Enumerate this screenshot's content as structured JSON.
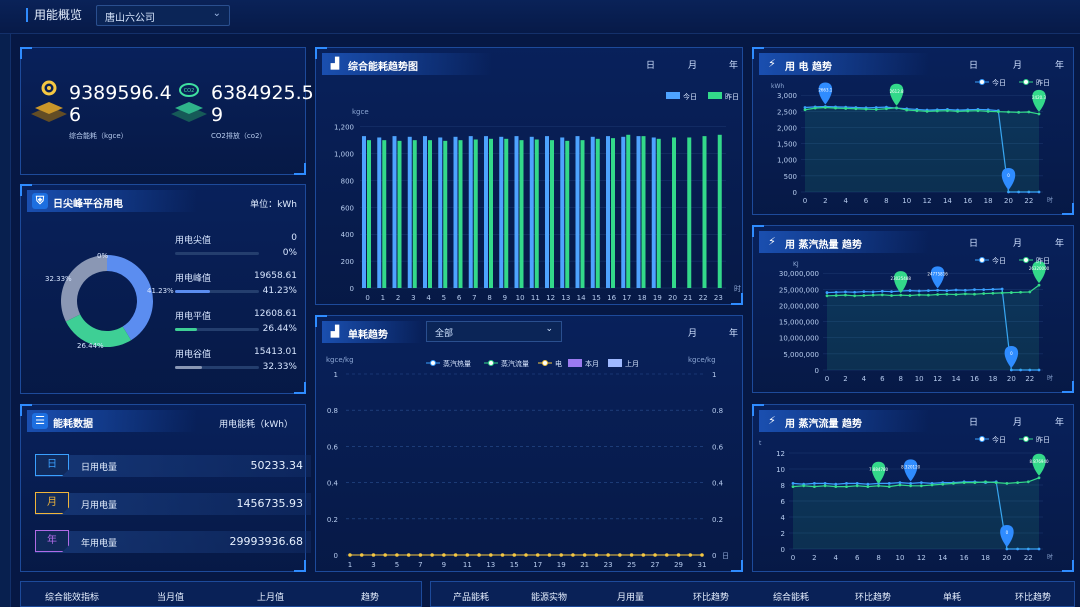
{
  "header": {
    "title": "用能概览",
    "company_select": "唐山六公司"
  },
  "overview": {
    "energy_value": "9389596.46",
    "energy_label": "综合能耗（kgce）",
    "co2_value": "6384925.59",
    "co2_label": "CO2排放（co2）"
  },
  "peak_valley": {
    "title": "日尖峰平谷用电",
    "unit": "单位：kWh",
    "rows": [
      {
        "label": "用电尖值",
        "value": "0",
        "pct": "0%",
        "fraction": 0,
        "color": "#8aa2c8"
      },
      {
        "label": "用电峰值",
        "value": "19658.61",
        "pct": "41.23%",
        "fraction": 0.4123,
        "color": "#5b8df0"
      },
      {
        "label": "用电平值",
        "value": "12608.61",
        "pct": "26.44%",
        "fraction": 0.2644,
        "color": "#3ecf95"
      },
      {
        "label": "用电谷值",
        "value": "15413.01",
        "pct": "32.33%",
        "fraction": 0.3233,
        "color": "#8a97b4"
      }
    ],
    "donut_labels": {
      "jian": "0%",
      "feng": "41.23%",
      "ping": "26.44%",
      "gu": "32.33%"
    }
  },
  "energy_data": {
    "title": "能耗数据",
    "unit": "用电能耗（kWh）",
    "rows": [
      {
        "tag": "日",
        "label": "日用电量",
        "value": "50233.34",
        "color": "#3aa0ff"
      },
      {
        "tag": "月",
        "label": "月用电量",
        "value": "1456735.93",
        "color": "#f0b53a"
      },
      {
        "tag": "年",
        "label": "年用电量",
        "value": "29993936.68",
        "color": "#b06be6"
      }
    ]
  },
  "trend": {
    "title": "综合能耗趋势图",
    "tabs": [
      "日",
      "月",
      "年"
    ],
    "legend": [
      "今日",
      "昨日"
    ],
    "yunit": "kgce",
    "xunit": "时",
    "chart_data": {
      "type": "bar",
      "categories": [
        "0",
        "1",
        "2",
        "3",
        "4",
        "5",
        "6",
        "7",
        "8",
        "9",
        "10",
        "11",
        "12",
        "13",
        "14",
        "15",
        "16",
        "17",
        "18",
        "19",
        "20",
        "21",
        "22",
        "23"
      ],
      "yticks": [
        "0",
        "200",
        "400",
        "600",
        "800",
        "1,000",
        "1,200"
      ],
      "ylim": [
        0,
        1250
      ],
      "series": [
        {
          "name": "今日",
          "color": "#4ea3ff",
          "values": [
            1130,
            1120,
            1130,
            1125,
            1130,
            1120,
            1125,
            1130,
            1130,
            1125,
            1130,
            1125,
            1130,
            1120,
            1130,
            1125,
            1130,
            1125,
            1130,
            1120,
            null,
            null,
            null,
            null
          ]
        },
        {
          "name": "昨日",
          "color": "#33d98a",
          "values": [
            1100,
            1100,
            1095,
            1100,
            1100,
            1095,
            1100,
            1105,
            1110,
            1110,
            1100,
            1105,
            1100,
            1095,
            1100,
            1110,
            1115,
            1140,
            1130,
            1110,
            1120,
            1120,
            1130,
            1140
          ]
        }
      ]
    }
  },
  "unit_trend": {
    "title": "单耗趋势",
    "select": "全部",
    "tabs": [
      "月",
      "年"
    ],
    "yunit_left": "kgce/kg",
    "yunit_right": "kgce/kg",
    "xunit": "日",
    "legend": [
      "蒸汽热量",
      "蒸汽流量",
      "电",
      "本月",
      "上月"
    ],
    "chart_data": {
      "type": "line",
      "x": [
        "1",
        "3",
        "5",
        "7",
        "9",
        "11",
        "13",
        "15",
        "17",
        "19",
        "21",
        "23",
        "25",
        "27",
        "29",
        "31"
      ],
      "yticks": [
        "0",
        "0.2",
        "0.4",
        "0.6",
        "0.8",
        "1"
      ],
      "ylim": [
        0,
        1
      ],
      "series": [
        {
          "name": "电",
          "color": "#f5c842",
          "values": [
            0,
            0,
            0,
            0,
            0,
            0,
            0,
            0,
            0,
            0,
            0,
            0,
            0,
            0,
            0,
            0,
            0,
            0,
            0,
            0,
            0,
            0,
            0,
            0,
            0,
            0,
            0,
            0,
            0,
            0,
            0
          ]
        }
      ]
    }
  },
  "power": {
    "title": "用 电 趋势",
    "tabs": [
      "日",
      "月",
      "年"
    ],
    "legend": [
      "今日",
      "昨日"
    ],
    "yunit": "kWh",
    "xunit": "时",
    "chart_data": {
      "type": "line",
      "x": [
        "0",
        "2",
        "4",
        "6",
        "8",
        "10",
        "12",
        "14",
        "16",
        "18",
        "20",
        "22"
      ],
      "yticks": [
        "0",
        "500",
        "1,000",
        "1,500",
        "2,000",
        "2,500",
        "3,000"
      ],
      "ylim": [
        0,
        3100
      ],
      "series": [
        {
          "name": "今日",
          "color": "#3aa0ff",
          "values": [
            2620,
            2640,
            2650,
            2640,
            2630,
            2620,
            2610,
            2620,
            2630,
            2600,
            2580,
            2560,
            2540,
            2550,
            2560,
            2540,
            2550,
            2560,
            2550,
            2520,
            0,
            0,
            0,
            0
          ]
        },
        {
          "name": "昨日",
          "color": "#33d98a",
          "values": [
            2550,
            2600,
            2620,
            2600,
            2590,
            2580,
            2570,
            2560,
            2580,
            2610,
            2540,
            2520,
            2500,
            2510,
            2520,
            2500,
            2510,
            2520,
            2500,
            2490,
            2480,
            2470,
            2480,
            2420
          ]
        }
      ],
      "markers": [
        {
          "x": "2",
          "label": "2663.1",
          "color": "#2f8cff",
          "series": "今日"
        },
        {
          "x": "9",
          "label": "2612.8",
          "color": "#33d98a",
          "series": "昨日"
        },
        {
          "x": "20",
          "label": "0",
          "color": "#2f8cff",
          "series": "今日"
        },
        {
          "x": "23",
          "label": "2420.3",
          "color": "#33d98a",
          "series": "昨日"
        }
      ]
    }
  },
  "steam_heat": {
    "title": "用 蒸汽热量 趋势",
    "tabs": [
      "日",
      "月",
      "年"
    ],
    "legend": [
      "今日",
      "昨日"
    ],
    "yunit": "KJ",
    "xunit": "时",
    "chart_data": {
      "type": "line",
      "x": [
        "0",
        "2",
        "4",
        "6",
        "8",
        "10",
        "12",
        "14",
        "16",
        "18",
        "20",
        "22"
      ],
      "yticks": [
        "0",
        "5,000,000",
        "10,000,000",
        "15,000,000",
        "20,000,000",
        "25,000,000",
        "30,000,000"
      ],
      "ylim": [
        0,
        31000000
      ],
      "series": [
        {
          "name": "今日",
          "color": "#3aa0ff",
          "values": [
            24000000,
            24100000,
            24200000,
            24100000,
            24300000,
            24200000,
            24400000,
            24300000,
            24500000,
            24600000,
            24500000,
            24600000,
            24700000,
            24600000,
            24800000,
            24700000,
            24900000,
            24900000,
            25000000,
            25100000,
            0,
            0,
            0,
            0
          ]
        },
        {
          "name": "昨日",
          "color": "#33d98a",
          "values": [
            23000000,
            23100000,
            23200000,
            23000000,
            23100000,
            23200000,
            23300000,
            23100000,
            23200000,
            23100000,
            23300000,
            23200000,
            23400000,
            23500000,
            23400000,
            23600000,
            23500000,
            23700000,
            23800000,
            23900000,
            24000000,
            24100000,
            24200000,
            26300000
          ]
        }
      ],
      "markers": [
        {
          "x": "8",
          "label": "23025488",
          "color": "#33d98a",
          "series": "昨日"
        },
        {
          "x": "12",
          "label": "24775816",
          "color": "#2f8cff",
          "series": "今日"
        },
        {
          "x": "20",
          "label": "0",
          "color": "#2f8cff",
          "series": "今日"
        },
        {
          "x": "23",
          "label": "26320000",
          "color": "#33d98a",
          "series": "昨日"
        }
      ]
    }
  },
  "steam_flow": {
    "title": "用 蒸汽流量 趋势",
    "tabs": [
      "日",
      "月",
      "年"
    ],
    "legend": [
      "今日",
      "昨日"
    ],
    "yunit": "t",
    "xunit": "时",
    "chart_data": {
      "type": "line",
      "x": [
        "0",
        "2",
        "4",
        "6",
        "8",
        "10",
        "12",
        "14",
        "16",
        "18",
        "20",
        "22"
      ],
      "yticks": [
        "0",
        "2",
        "4",
        "6",
        "8",
        "10",
        "12"
      ],
      "ylim": [
        0,
        12.5
      ],
      "series": [
        {
          "name": "今日",
          "color": "#3aa0ff",
          "values": [
            8.2,
            8.1,
            8.2,
            8.2,
            8.1,
            8.2,
            8.2,
            8.1,
            8.2,
            8.2,
            8.3,
            8.2,
            8.3,
            8.2,
            8.3,
            8.3,
            8.4,
            8.4,
            8.3,
            8.4,
            0,
            0,
            0,
            0
          ]
        },
        {
          "name": "昨日",
          "color": "#33d98a",
          "values": [
            7.8,
            7.9,
            7.8,
            7.9,
            7.8,
            7.8,
            7.9,
            7.8,
            7.9,
            7.8,
            8.0,
            7.9,
            7.9,
            8.0,
            8.1,
            8.2,
            8.3,
            8.3,
            8.4,
            8.3,
            8.2,
            8.3,
            8.4,
            8.9
          ]
        }
      ],
      "markers": [
        {
          "x": "8",
          "label": "7.884780",
          "color": "#33d98a",
          "series": "昨日"
        },
        {
          "x": "11",
          "label": "8.320120",
          "color": "#2f8cff",
          "series": "今日"
        },
        {
          "x": "20",
          "label": "0",
          "color": "#2f8cff",
          "series": "今日"
        },
        {
          "x": "23",
          "label": "8.876940",
          "color": "#33d98a",
          "series": "昨日"
        }
      ]
    }
  },
  "table_left": [
    "综合能效指标",
    "当月值",
    "上月值",
    "趋势"
  ],
  "table_right": [
    "产品能耗",
    "能源实物",
    "月用量",
    "环比趋势",
    "综合能耗",
    "环比趋势",
    "单耗",
    "环比趋势"
  ]
}
